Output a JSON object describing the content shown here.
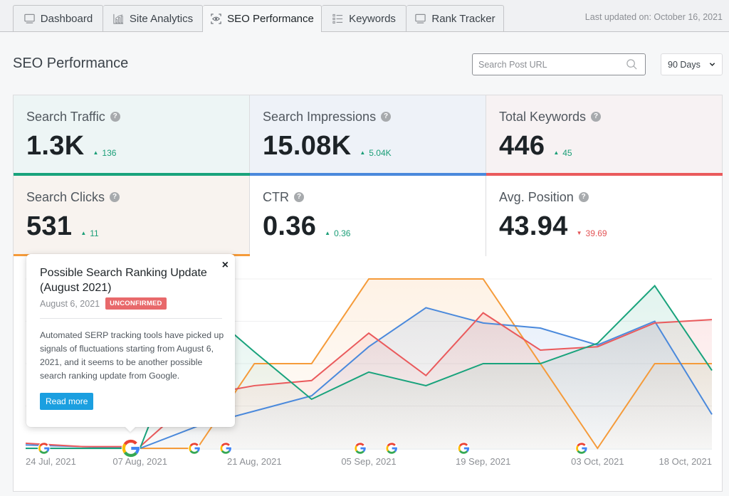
{
  "tabs": [
    {
      "label": "Dashboard",
      "icon": "monitor-icon",
      "active": false
    },
    {
      "label": "Site Analytics",
      "icon": "bar-chart-icon",
      "active": false
    },
    {
      "label": "SEO Performance",
      "icon": "eye-icon",
      "active": true
    },
    {
      "label": "Keywords",
      "icon": "list-icon",
      "active": false
    },
    {
      "label": "Rank Tracker",
      "icon": "monitor-icon",
      "active": false
    }
  ],
  "last_updated": "Last updated on: October 16, 2021",
  "page_title": "SEO Performance",
  "search": {
    "placeholder": "Search Post URL",
    "value": ""
  },
  "range_select": {
    "selected": "90 Days"
  },
  "stats": [
    {
      "label": "Search Traffic",
      "value": "1.3K",
      "delta": "136",
      "direction": "up",
      "accent": "#19a37c",
      "bg": "#edf5f5",
      "selected": true
    },
    {
      "label": "Search Impressions",
      "value": "15.08K",
      "delta": "5.04K",
      "direction": "up",
      "accent": "#4a89dc",
      "bg": "#eef2f8",
      "selected": true
    },
    {
      "label": "Total Keywords",
      "value": "446",
      "delta": "45",
      "direction": "up",
      "accent": "#ea5a5c",
      "bg": "#f7f2f3",
      "selected": true
    },
    {
      "label": "Search Clicks",
      "value": "531",
      "delta": "11",
      "direction": "up",
      "accent": "#f59b3a",
      "bg": "#f8f3ef",
      "selected": true
    },
    {
      "label": "CTR",
      "value": "0.36",
      "delta": "0.36",
      "direction": "up",
      "accent": "",
      "bg": "#ffffff",
      "selected": false
    },
    {
      "label": "Avg. Position",
      "value": "43.94",
      "delta": "39.69",
      "direction": "down",
      "accent": "",
      "bg": "#ffffff",
      "selected": false
    }
  ],
  "delta_colors": {
    "up": "#1a9e77",
    "down": "#e35456"
  },
  "popup": {
    "title": "Possible Search Ranking Update (August 2021)",
    "date": "August 6, 2021",
    "badge": "UNCONFIRMED",
    "body": "Automated SERP tracking tools have picked up signals of fluctuations starting from August 6, 2021, and it seems to be another possible search ranking update from Google.",
    "button": "Read more",
    "close": "×"
  },
  "chart_data": {
    "type": "area",
    "title": "",
    "xlabel": "",
    "ylabel": "",
    "ylim": [
      0,
      100
    ],
    "grid": true,
    "categories": [
      "24 Jul, 2021",
      "",
      "07 Aug, 2021",
      "",
      "21 Aug, 2021",
      "",
      "05 Sep, 2021",
      "",
      "19 Sep, 2021",
      "",
      "03 Oct, 2021",
      "",
      "18 Oct, 2021"
    ],
    "series": [
      {
        "name": "Search Clicks",
        "color": "#f59b3a",
        "values": [
          0,
          0,
          0,
          0,
          50,
          50,
          100,
          100,
          100,
          50,
          0,
          50,
          50
        ]
      },
      {
        "name": "Search Impressions",
        "color": "#4a89dc",
        "values": [
          2,
          1,
          0,
          13,
          22,
          31,
          60,
          83,
          74,
          71,
          61,
          75,
          20
        ]
      },
      {
        "name": "Total Keywords",
        "color": "#ea5a5c",
        "values": [
          3,
          1,
          1,
          31,
          37,
          40,
          68,
          43,
          80,
          58,
          60,
          74,
          76
        ]
      },
      {
        "name": "Search Traffic",
        "color": "#19a37c",
        "values": [
          0,
          0,
          0,
          86,
          57,
          29,
          45,
          37,
          50,
          50,
          62,
          96,
          46
        ]
      }
    ],
    "update_markers": [
      {
        "at": 0.32,
        "active": false
      },
      {
        "at": 1.84,
        "active": true
      },
      {
        "at": 2.95,
        "active": false
      },
      {
        "at": 3.5,
        "active": false
      },
      {
        "at": 5.85,
        "active": false
      },
      {
        "at": 6.4,
        "active": false
      },
      {
        "at": 7.66,
        "active": false
      },
      {
        "at": 9.72,
        "active": false
      }
    ]
  }
}
